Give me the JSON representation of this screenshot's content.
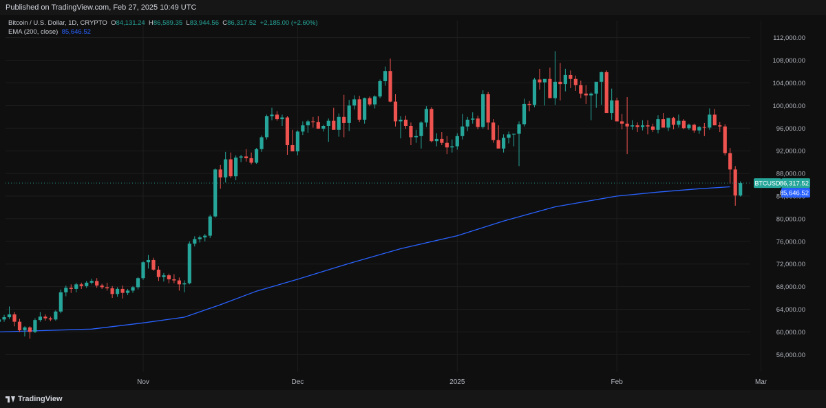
{
  "header": {
    "published": "Published on TradingView.com, Feb 27, 2025 10:49 UTC"
  },
  "legend": {
    "title": "Bitcoin / U.S. Dollar, 1D, CRYPTO",
    "o_label": "O",
    "o": "84,131.24",
    "h_label": "H",
    "h": "86,589.35",
    "l_label": "L",
    "l": "83,944.56",
    "c_label": "C",
    "c": "86,317.52",
    "change": "+2,185.00 (+2.60%)",
    "ema_label": "EMA (200, close)",
    "ema_value": "85,646.52"
  },
  "price_tags": {
    "symbol": "BTCUSD",
    "last": "86,317.52",
    "ema": "85,646.52"
  },
  "footer": {
    "brand": "TradingView"
  },
  "colors": {
    "up": "#26a69a",
    "down": "#ef5350",
    "ema": "#2962ff",
    "background": "#0f0f0f",
    "grid": "#1e1e1e"
  },
  "chart_data": {
    "type": "candlestick",
    "title": "Bitcoin / U.S. Dollar, 1D, CRYPTO",
    "y_ticks": [
      "56,000.00",
      "60,000.00",
      "64,000.00",
      "68,000.00",
      "72,000.00",
      "76,000.00",
      "80,000.00",
      "84,000.00",
      "88,000.00",
      "92,000.00",
      "96,000.00",
      "100,000.00",
      "104,000.00",
      "108,000.00",
      "112,000.00"
    ],
    "y_tick_values": [
      56000,
      60000,
      64000,
      68000,
      72000,
      76000,
      80000,
      84000,
      88000,
      92000,
      96000,
      100000,
      104000,
      108000,
      112000
    ],
    "x_ticks": [
      {
        "label": "Nov",
        "day": 0
      },
      {
        "label": "Dec",
        "day": 30
      },
      {
        "label": "2025",
        "day": 61
      },
      {
        "label": "Feb",
        "day": 92
      },
      {
        "label": "Mar",
        "day": 120
      }
    ],
    "ylim": [
      53000,
      115000
    ],
    "start_day": -28,
    "candles": [
      [
        61800,
        62400,
        61400,
        62200
      ],
      [
        62200,
        63000,
        61800,
        62600
      ],
      [
        62600,
        64500,
        62300,
        63100
      ],
      [
        63100,
        63500,
        61000,
        61800
      ],
      [
        61800,
        62300,
        60000,
        60300
      ],
      [
        60300,
        61000,
        59200,
        60800
      ],
      [
        60800,
        61000,
        58800,
        60000
      ],
      [
        60000,
        62400,
        59800,
        62100
      ],
      [
        62100,
        63500,
        61800,
        62700
      ],
      [
        62700,
        63100,
        62000,
        62400
      ],
      [
        62400,
        62700,
        61900,
        62200
      ],
      [
        62200,
        63800,
        62000,
        63600
      ],
      [
        63600,
        67500,
        63300,
        67000
      ],
      [
        67000,
        68200,
        66300,
        67800
      ],
      [
        67800,
        68400,
        66900,
        67600
      ],
      [
        67600,
        68700,
        67000,
        68400
      ],
      [
        68400,
        68700,
        67600,
        68100
      ],
      [
        68100,
        69000,
        67800,
        68700
      ],
      [
        68700,
        69400,
        68400,
        69000
      ],
      [
        69000,
        69500,
        67800,
        68200
      ],
      [
        68200,
        68500,
        67600,
        67900
      ],
      [
        67900,
        68700,
        67300,
        67700
      ],
      [
        67700,
        68100,
        66000,
        66700
      ],
      [
        66700,
        67900,
        66200,
        67600
      ],
      [
        67600,
        68200,
        65900,
        66900
      ],
      [
        66900,
        67600,
        66500,
        67300
      ],
      [
        67300,
        68100,
        66900,
        67900
      ],
      [
        67900,
        69700,
        67500,
        69500
      ],
      [
        69500,
        72500,
        69200,
        72300
      ],
      [
        72300,
        73600,
        71200,
        72700
      ],
      [
        72700,
        73100,
        70800,
        71000
      ],
      [
        71000,
        71600,
        69000,
        69700
      ],
      [
        69700,
        70400,
        68900,
        70000
      ],
      [
        70000,
        70300,
        68600,
        69300
      ],
      [
        69300,
        70200,
        68600,
        69100
      ],
      [
        69100,
        69600,
        67300,
        68400
      ],
      [
        68400,
        69100,
        67000,
        68600
      ],
      [
        68600,
        76000,
        68400,
        75600
      ],
      [
        75600,
        76900,
        75100,
        76400
      ],
      [
        76400,
        77000,
        75800,
        76700
      ],
      [
        76700,
        77300,
        76000,
        77000
      ],
      [
        77000,
        80700,
        76600,
        80400
      ],
      [
        80400,
        88900,
        80200,
        88700
      ],
      [
        88700,
        89500,
        85300,
        87300
      ],
      [
        87300,
        91800,
        86400,
        90500
      ],
      [
        90500,
        91700,
        87200,
        87500
      ],
      [
        87500,
        91200,
        86800,
        90800
      ],
      [
        90800,
        91300,
        90000,
        91000
      ],
      [
        91000,
        92300,
        90100,
        90700
      ],
      [
        90700,
        91700,
        89600,
        89900
      ],
      [
        89900,
        92500,
        89700,
        92300
      ],
      [
        92300,
        94700,
        91800,
        94400
      ],
      [
        94400,
        98400,
        94000,
        98100
      ],
      [
        98100,
        99600,
        97400,
        98400
      ],
      [
        98400,
        99000,
        97300,
        97600
      ],
      [
        97600,
        98400,
        96400,
        97900
      ],
      [
        97900,
        98100,
        91300,
        93000
      ],
      [
        93000,
        95700,
        92000,
        91900
      ],
      [
        91900,
        95600,
        91200,
        95400
      ],
      [
        95400,
        97200,
        94800,
        96500
      ],
      [
        96500,
        97500,
        95200,
        97200
      ],
      [
        97200,
        98000,
        96100,
        97100
      ],
      [
        97100,
        98100,
        95900,
        95900
      ],
      [
        95900,
        96600,
        95400,
        96400
      ],
      [
        96400,
        97700,
        93600,
        97300
      ],
      [
        97300,
        99600,
        96000,
        95700
      ],
      [
        95700,
        98600,
        94500,
        98000
      ],
      [
        98000,
        101900,
        94400,
        96900
      ],
      [
        96900,
        101000,
        95500,
        100000
      ],
      [
        100000,
        101800,
        99300,
        101100
      ],
      [
        101100,
        101700,
        97100,
        97500
      ],
      [
        97500,
        101400,
        96800,
        101300
      ],
      [
        101300,
        101600,
        99900,
        100200
      ],
      [
        100200,
        101800,
        99500,
        101600
      ],
      [
        101600,
        104600,
        101300,
        104300
      ],
      [
        104300,
        106900,
        103500,
        106100
      ],
      [
        106100,
        108300,
        100600,
        100700
      ],
      [
        100700,
        102000,
        96300,
        97200
      ],
      [
        97200,
        98100,
        94200,
        97500
      ],
      [
        97500,
        98200,
        95900,
        96400
      ],
      [
        96400,
        97000,
        93000,
        94400
      ],
      [
        94400,
        95700,
        93400,
        94600
      ],
      [
        94600,
        97200,
        92400,
        97000
      ],
      [
        97000,
        99900,
        96200,
        99400
      ],
      [
        99400,
        99700,
        93500,
        93700
      ],
      [
        93700,
        95100,
        92800,
        94100
      ],
      [
        94100,
        95300,
        93000,
        93400
      ],
      [
        93400,
        94600,
        91400,
        92600
      ],
      [
        92600,
        94000,
        91700,
        92800
      ],
      [
        92800,
        95100,
        92200,
        94600
      ],
      [
        94600,
        98500,
        94000,
        96300
      ],
      [
        96300,
        98000,
        95500,
        97500
      ],
      [
        97500,
        98800,
        96800,
        97700
      ],
      [
        97700,
        98200,
        95800,
        96200
      ],
      [
        96200,
        102700,
        95900,
        102000
      ],
      [
        102000,
        102400,
        95700,
        97000
      ],
      [
        97000,
        97600,
        93400,
        93900
      ],
      [
        93900,
        96500,
        93300,
        92400
      ],
      [
        92400,
        94900,
        91700,
        94300
      ],
      [
        94300,
        95400,
        93300,
        94900
      ],
      [
        94900,
        95000,
        92800,
        95000
      ],
      [
        95000,
        97200,
        89300,
        96700
      ],
      [
        96700,
        101200,
        96300,
        100300
      ],
      [
        100300,
        100800,
        99000,
        100100
      ],
      [
        100100,
        104900,
        99700,
        104600
      ],
      [
        104600,
        106500,
        102800,
        104100
      ],
      [
        104100,
        104700,
        100000,
        104700
      ],
      [
        104700,
        106700,
        102700,
        101300
      ],
      [
        101300,
        109600,
        100100,
        104200
      ],
      [
        104200,
        107500,
        100900,
        103800
      ],
      [
        103800,
        106500,
        102500,
        105400
      ],
      [
        105400,
        106200,
        103100,
        104700
      ],
      [
        104700,
        105300,
        102600,
        103600
      ],
      [
        103600,
        104400,
        101300,
        102100
      ],
      [
        102100,
        103600,
        100300,
        101800
      ],
      [
        101800,
        102300,
        97400,
        102100
      ],
      [
        102100,
        104000,
        99600,
        104200
      ],
      [
        104200,
        106000,
        100100,
        105900
      ],
      [
        105900,
        106200,
        99600,
        98700
      ],
      [
        98700,
        103000,
        97500,
        100900
      ],
      [
        100900,
        101400,
        97200,
        97200
      ],
      [
        97200,
        98500,
        95800,
        96800
      ],
      [
        96800,
        101500,
        91400,
        96300
      ],
      [
        96300,
        97400,
        95700,
        96500
      ],
      [
        96500,
        97000,
        95300,
        96200
      ],
      [
        96200,
        97400,
        95600,
        96500
      ],
      [
        96500,
        97400,
        94900,
        96300
      ],
      [
        96300,
        96800,
        95300,
        95700
      ],
      [
        95700,
        98300,
        95100,
        97600
      ],
      [
        97600,
        98700,
        96400,
        96100
      ],
      [
        96100,
        97800,
        95500,
        97800
      ],
      [
        97800,
        98000,
        95800,
        96600
      ],
      [
        96600,
        98400,
        96100,
        97300
      ],
      [
        97300,
        97600,
        95800,
        96000
      ],
      [
        96000,
        96800,
        95700,
        96600
      ],
      [
        96600,
        96800,
        95200,
        95600
      ],
      [
        95600,
        96400,
        95000,
        96200
      ],
      [
        96200,
        96900,
        94600,
        96100
      ],
      [
        96100,
        99500,
        95700,
        98400
      ],
      [
        98400,
        99400,
        96500,
        96500
      ],
      [
        96500,
        97100,
        95300,
        96300
      ],
      [
        96300,
        96700,
        91200,
        91600
      ],
      [
        91600,
        92500,
        86200,
        88700
      ],
      [
        88700,
        89300,
        82300,
        84100
      ],
      [
        84100,
        86600,
        83900,
        86300
      ]
    ],
    "ema_points": [
      [
        -28,
        60000
      ],
      [
        -10,
        60500
      ],
      [
        0,
        61600
      ],
      [
        8,
        62600
      ],
      [
        15,
        64800
      ],
      [
        22,
        67200
      ],
      [
        30,
        69300
      ],
      [
        40,
        72100
      ],
      [
        50,
        74700
      ],
      [
        61,
        77000
      ],
      [
        70,
        79600
      ],
      [
        80,
        82100
      ],
      [
        92,
        84000
      ],
      [
        100,
        84700
      ],
      [
        108,
        85300
      ],
      [
        114,
        85646.52
      ]
    ]
  }
}
